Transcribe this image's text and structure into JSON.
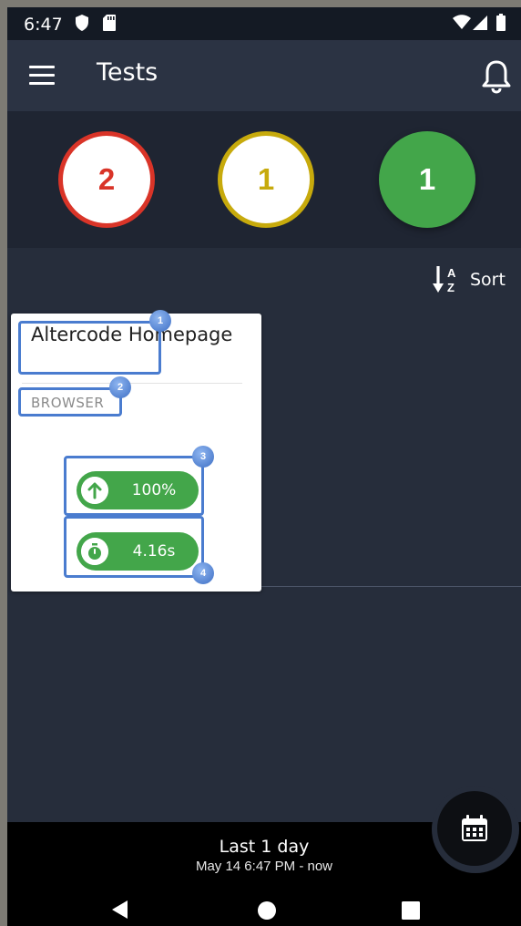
{
  "status_bar": {
    "time": "6:47"
  },
  "app_bar": {
    "title": "Tests"
  },
  "summary": {
    "failed": {
      "count": "2",
      "color": "#d93428"
    },
    "warning": {
      "count": "1",
      "color": "#c7aa0c"
    },
    "passed": {
      "count": "1",
      "color": "#43a64a"
    }
  },
  "sort": {
    "label": "Sort"
  },
  "card": {
    "title": "Altercode Homepage",
    "type": "BROWSER",
    "uptime": "100%",
    "response_time": "4.16s"
  },
  "annotations": [
    "1",
    "2",
    "3",
    "4"
  ],
  "range": {
    "title": "Last 1 day",
    "subtitle": "May 14 6:47 PM - now"
  },
  "icons": [
    "shield-icon",
    "sd-card-icon",
    "wifi-icon",
    "signal-icon",
    "battery-icon",
    "menu-icon",
    "bell-icon",
    "sort-alpha-icon",
    "arrow-up-icon",
    "stopwatch-icon",
    "calendar-icon",
    "back-icon",
    "home-icon",
    "recents-icon"
  ]
}
